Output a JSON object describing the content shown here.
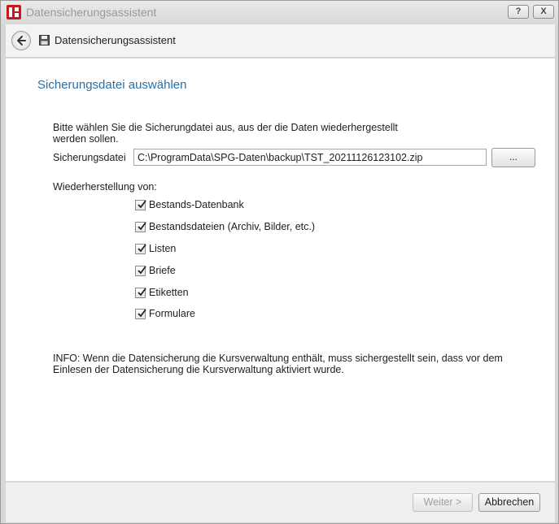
{
  "window": {
    "title": "Datensicherungsassistent",
    "help_label": "?",
    "close_label": "X"
  },
  "header": {
    "title": "Datensicherungsassistent"
  },
  "page": {
    "title": "Sicherungsdatei auswählen",
    "intro": "Bitte wählen Sie die Sicherungdatei aus, aus der die Daten wiederhergestellt werden sollen.",
    "file_label": "Sicherungsdatei",
    "file_value": "C:\\ProgramData\\SPG-Daten\\backup\\TST_20211126123102.zip",
    "browse_label": "...",
    "restore_label": "Wiederherstellung von:",
    "options": [
      {
        "label": "Bestands-Datenbank",
        "checked": true
      },
      {
        "label": "Bestandsdateien (Archiv, Bilder, etc.)",
        "checked": true
      },
      {
        "label": "Listen",
        "checked": true
      },
      {
        "label": "Briefe",
        "checked": true
      },
      {
        "label": "Etiketten",
        "checked": true
      },
      {
        "label": "Formulare",
        "checked": true
      }
    ],
    "info": "INFO: Wenn die Datensicherung die Kursverwaltung enthält, muss sichergestellt sein, dass vor dem Einlesen der Datensicherung die Kursverwaltung aktiviert wurde."
  },
  "footer": {
    "next_label": "Weiter >",
    "cancel_label": "Abbrechen"
  },
  "colors": {
    "accent": "#2a6fa8",
    "brand": "#c21a1f"
  }
}
